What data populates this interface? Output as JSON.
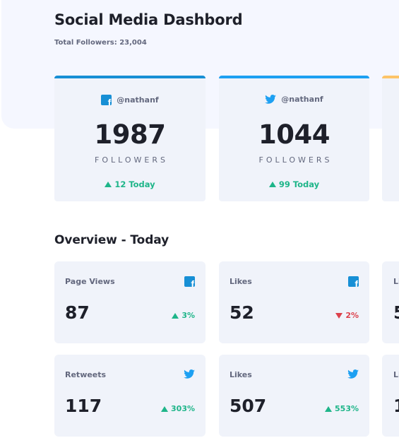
{
  "header": {
    "title": "Social Media Dashbord",
    "total_followers": "Total Followers: 23,004"
  },
  "colors": {
    "facebook": "#178fd5",
    "twitter": "#1da0f2",
    "instagram_bar": "#fdc468",
    "up": "#1eb589",
    "down": "#dc414c"
  },
  "follower_cards": [
    {
      "platform_icon": "facebook-icon",
      "handle": "@nathanf",
      "count": "1987",
      "unit": "FOLLOWERS",
      "today": "12 Today"
    },
    {
      "platform_icon": "twitter-icon",
      "handle": "@nathanf",
      "count": "1044",
      "unit": "FOLLOWERS",
      "today": "99 Today"
    }
  ],
  "overview": {
    "title": "Overview - Today",
    "cards": [
      {
        "metric": "Page Views",
        "platform_icon": "facebook-icon",
        "value": "87",
        "change": "3%",
        "trend": "up"
      },
      {
        "metric": "Likes",
        "platform_icon": "facebook-icon",
        "value": "52",
        "change": "2%",
        "trend": "down"
      },
      {
        "metric": "Retweets",
        "platform_icon": "twitter-icon",
        "value": "117",
        "change": "303%",
        "trend": "up"
      },
      {
        "metric": "Likes",
        "platform_icon": "twitter-icon",
        "value": "507",
        "change": "553%",
        "trend": "up"
      }
    ],
    "peek": [
      {
        "label": "Li",
        "value": "5"
      },
      {
        "label": "Li",
        "value": "1"
      }
    ]
  }
}
